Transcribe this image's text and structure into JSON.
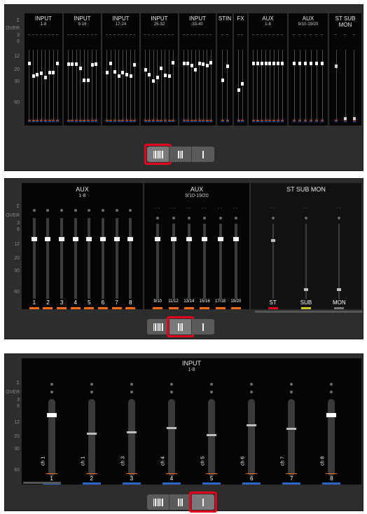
{
  "scale_labels": {
    "sigma": "Σ",
    "over": "OVER",
    "s3": "3",
    "s6": "6",
    "s12": "12",
    "s20": "20",
    "s30": "30",
    "s60": "60"
  },
  "overview": {
    "groups": [
      {
        "title": "INPUT",
        "sub": "1-8"
      },
      {
        "title": "INPUT",
        "sub": "9-16"
      },
      {
        "title": "INPUT",
        "sub": "17-24"
      },
      {
        "title": "INPUT",
        "sub": "25-32"
      },
      {
        "title": "INPUT",
        "sub": "33-40"
      },
      {
        "title": "STIN",
        "sub": ""
      },
      {
        "title": "FX",
        "sub": ""
      },
      {
        "title": "AUX",
        "sub": "1-8"
      },
      {
        "title": "AUX",
        "sub": "9/10-19/20"
      },
      {
        "title": "ST SUB MON",
        "sub": ""
      }
    ],
    "fader_levels_input_1_40": [
      0.92,
      0.72,
      0.74,
      0.77,
      0.7,
      0.78,
      0.78,
      0.92,
      0.91,
      0.91,
      0.91,
      0.85,
      0.66,
      0.66,
      0.9,
      0.91,
      0.78,
      0.92,
      0.79,
      0.72,
      0.78,
      0.75,
      0.72,
      0.9,
      0.82,
      0.74,
      0.65,
      0.7,
      0.85,
      0.73,
      0.72,
      0.93,
      0.92,
      0.92,
      0.89,
      0.82,
      0.92,
      0.91,
      0.89,
      0.93
    ],
    "fader_levels_stin": [
      0.66,
      0.88
    ],
    "fader_levels_fx": [
      0.5,
      0.6
    ]
  },
  "aux_view": {
    "groups": [
      {
        "title": "AUX",
        "sub": "1-8",
        "channels": [
          "1",
          "2",
          "3",
          "4",
          "5",
          "6",
          "7",
          "8"
        ]
      },
      {
        "title": "AUX",
        "sub": "9/10-19/20",
        "channels": [
          "9/10",
          "11/12",
          "13/14",
          "15/16",
          "17/18",
          "19/20"
        ]
      },
      {
        "title": "ST SUB MON",
        "sub": "",
        "channels": [
          "ST",
          "SUB",
          "MON"
        ]
      }
    ],
    "dash": "- -"
  },
  "input_view": {
    "title": "INPUT",
    "sub": "1-8",
    "channels": [
      {
        "name": "ch 1",
        "num": "1",
        "level": 0.82
      },
      {
        "name": "ch 1",
        "num": "2",
        "level": 0.56
      },
      {
        "name": "ch 3",
        "num": "3",
        "level": 0.58
      },
      {
        "name": "ch 4",
        "num": "4",
        "level": 0.64
      },
      {
        "name": "ch 5",
        "num": "5",
        "level": 0.55
      },
      {
        "name": "ch 6",
        "num": "6",
        "level": 0.67
      },
      {
        "name": "ch 7",
        "num": "7",
        "level": 0.63
      },
      {
        "name": "ch 8",
        "num": "8",
        "level": 0.82
      }
    ]
  },
  "view_selector": {
    "options": [
      "wide-view",
      "medium-view",
      "single-view"
    ],
    "active_panel1": "wide-view",
    "active_panel2": "medium-view",
    "active_panel3": "single-view"
  },
  "colors": {
    "orange": "#ff6a1a",
    "blue": "#2a66c8",
    "red": "#e3001b",
    "yellow": "#c8c820"
  }
}
